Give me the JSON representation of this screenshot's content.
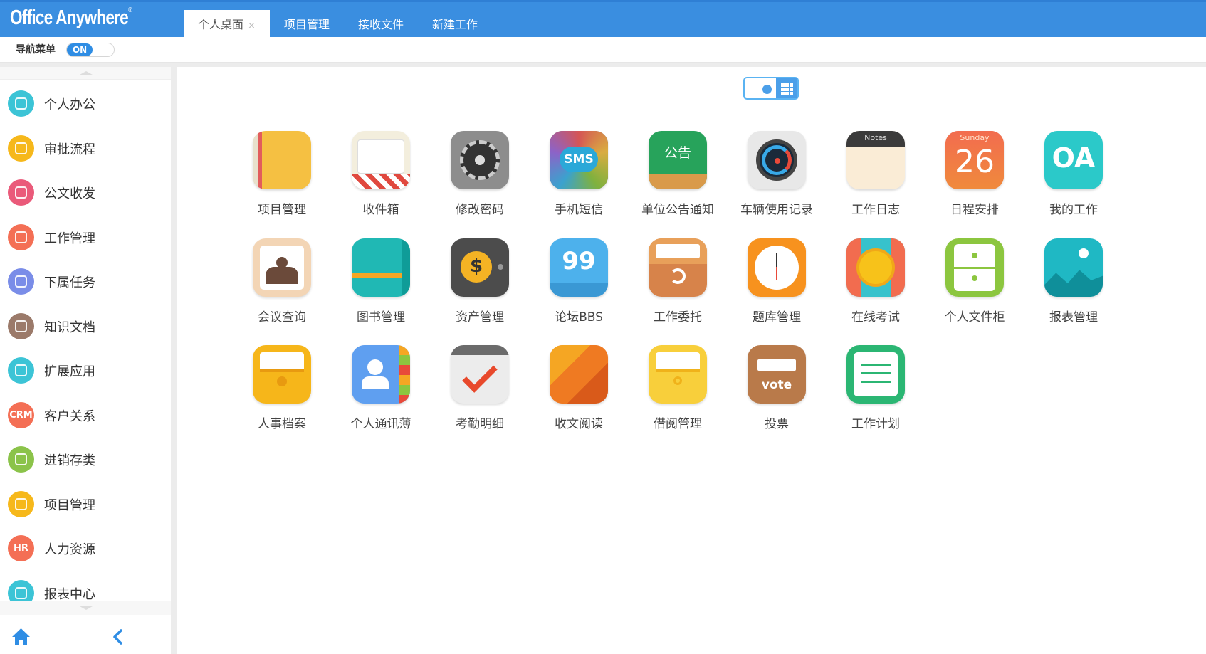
{
  "header": {
    "logo": "Office Anywhere",
    "logo_mark": "®",
    "tabs": [
      {
        "label": "个人桌面",
        "active": true,
        "close": "×"
      },
      {
        "label": "项目管理",
        "active": false
      },
      {
        "label": "接收文件",
        "active": false
      },
      {
        "label": "新建工作",
        "active": false
      }
    ]
  },
  "navbar": {
    "label": "导航菜单",
    "toggle": "ON"
  },
  "sidebar": {
    "items": [
      {
        "label": "个人办公",
        "color": "#3cc4d6",
        "icon": "user-icon"
      },
      {
        "label": "审批流程",
        "color": "#f6b81b",
        "icon": "approval-icon"
      },
      {
        "label": "公文收发",
        "color": "#ea5a7a",
        "icon": "document-send-icon"
      },
      {
        "label": "工作管理",
        "color": "#f46f55",
        "icon": "work-icon"
      },
      {
        "label": "下属任务",
        "color": "#7a8de8",
        "icon": "team-icon"
      },
      {
        "label": "知识文档",
        "color": "#9b7a6a",
        "icon": "book-icon"
      },
      {
        "label": "扩展应用",
        "color": "#3cc4d6",
        "icon": "extend-icon"
      },
      {
        "label": "客户关系",
        "color": "#f46f55",
        "icon": "crm-icon",
        "text": "CRM"
      },
      {
        "label": "进销存类",
        "color": "#8bc34a",
        "icon": "inventory-icon"
      },
      {
        "label": "项目管理",
        "color": "#f6b81b",
        "icon": "project-icon"
      },
      {
        "label": "人力资源",
        "color": "#f46f55",
        "icon": "hr-icon",
        "text": "HR"
      },
      {
        "label": "报表中心",
        "color": "#3cc4d6",
        "icon": "report-icon"
      }
    ],
    "home_icon": "home-icon",
    "collapse_icon": "chevron-left-icon"
  },
  "view_switch": {
    "icons": [
      "dot-view-icon",
      "grid-view-icon"
    ]
  },
  "apps": [
    {
      "label": "项目管理",
      "icon": "project-folder-icon",
      "color": "#f5c042"
    },
    {
      "label": "收件箱",
      "icon": "inbox-envelope-icon",
      "color": "#f3eedd"
    },
    {
      "label": "修改密码",
      "icon": "settings-gear-icon",
      "color": "#8d8d8d"
    },
    {
      "label": "手机短信",
      "icon": "sms-icon",
      "color": "#3a3a3a",
      "text": "SMS"
    },
    {
      "label": "单位公告通知",
      "icon": "notice-board-icon",
      "color": "#27a35b",
      "text": "公告"
    },
    {
      "label": "车辆使用记录",
      "icon": "speedometer-icon",
      "color": "#e8e8e8"
    },
    {
      "label": "工作日志",
      "icon": "notes-icon",
      "color": "#faecd6",
      "text": "Notes"
    },
    {
      "label": "日程安排",
      "icon": "calendar-icon",
      "color": "#f0714d",
      "text": "26",
      "subtext": "Sunday"
    },
    {
      "label": "我的工作",
      "icon": "oa-icon",
      "color": "#2bc9c9",
      "text": "OA"
    },
    {
      "label": "会议查询",
      "icon": "meeting-icon",
      "color": "#f3d5b5"
    },
    {
      "label": "图书管理",
      "icon": "book-manage-icon",
      "color": "#20b8b4"
    },
    {
      "label": "资产管理",
      "icon": "asset-safe-icon",
      "color": "#4c4c4c",
      "text": "$"
    },
    {
      "label": "论坛BBS",
      "icon": "forum-quote-icon",
      "color": "#4db1ec",
      "text": "99"
    },
    {
      "label": "工作委托",
      "icon": "delegate-icon",
      "color": "#d7834a"
    },
    {
      "label": "题库管理",
      "icon": "clock-icon",
      "color": "#f7921e"
    },
    {
      "label": "在线考试",
      "icon": "exam-coin-icon",
      "color": "#37c2cc"
    },
    {
      "label": "个人文件柜",
      "icon": "cabinet-icon",
      "color": "#8cc63f"
    },
    {
      "label": "报表管理",
      "icon": "report-chart-icon",
      "color": "#1fb8c4"
    },
    {
      "label": "人事档案",
      "icon": "personnel-file-icon",
      "color": "#f6b61a"
    },
    {
      "label": "个人通讯薄",
      "icon": "contacts-icon",
      "color": "#5f9ff0"
    },
    {
      "label": "考勤明细",
      "icon": "attendance-check-icon",
      "color": "#ececec"
    },
    {
      "label": "收文阅读",
      "icon": "reading-icon",
      "color": "#f07e2c"
    },
    {
      "label": "借阅管理",
      "icon": "borrow-folder-icon",
      "color": "#f8cf3b"
    },
    {
      "label": "投票",
      "icon": "vote-box-icon",
      "color": "#b97a4a",
      "text": "vote"
    },
    {
      "label": "工作计划",
      "icon": "work-plan-icon",
      "color": "#2bb673"
    }
  ]
}
